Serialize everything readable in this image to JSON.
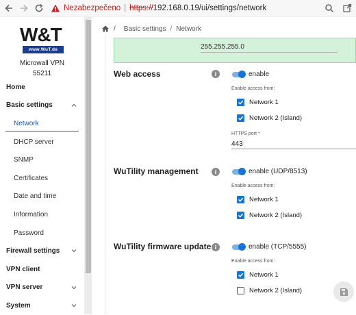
{
  "browser": {
    "insecure_label": "Nezabezpečeno",
    "url_scheme": "https://",
    "url_rest": "192.168.0.19/ui/settings/network"
  },
  "sidebar": {
    "logo_text": "W&T",
    "logo_sub": "www.WuT.de",
    "device_name": "Microwall VPN",
    "device_id": "55211",
    "items": [
      {
        "label": "Home",
        "type": "top"
      },
      {
        "label": "Basic settings",
        "type": "top",
        "chevron": "up"
      },
      {
        "label": "Network",
        "type": "sub",
        "active": true
      },
      {
        "label": "DHCP server",
        "type": "sub"
      },
      {
        "label": "SNMP",
        "type": "sub"
      },
      {
        "label": "Certificates",
        "type": "sub"
      },
      {
        "label": "Date and time",
        "type": "sub"
      },
      {
        "label": "Information",
        "type": "sub"
      },
      {
        "label": "Password",
        "type": "sub"
      },
      {
        "label": "Firewall settings",
        "type": "top",
        "chevron": "down"
      },
      {
        "label": "VPN client",
        "type": "top"
      },
      {
        "label": "VPN server",
        "type": "top",
        "chevron": "down"
      },
      {
        "label": "System",
        "type": "top",
        "chevron": "down"
      }
    ]
  },
  "breadcrumb": {
    "items": [
      "Basic settings",
      "Network"
    ]
  },
  "network": {
    "subnet_mask_value": "255.255.255.0"
  },
  "web_access": {
    "title": "Web access",
    "toggle_label": "enable",
    "enabled": true,
    "access_from_label": "Enable access from:",
    "network1": "Network 1",
    "network1_checked": true,
    "network2": "Network 2 (Island)",
    "network2_checked": true,
    "port_label": "HTTPS port *",
    "port_value": "443"
  },
  "wutility": {
    "title": "WuTility management",
    "toggle_label": "enable (UDP/8513)",
    "enabled": true,
    "access_from_label": "Enable access from:",
    "network1": "Network 1",
    "network1_checked": true,
    "network2": "Network 2 (Island)",
    "network2_checked": true
  },
  "firmware": {
    "title": "WuTility firmware update",
    "toggle_label": "enable (TCP/5555)",
    "enabled": true,
    "access_from_label": "Enable access from:",
    "network1": "Network 1",
    "network1_checked": true,
    "network2": "Network 2 (Island)",
    "network2_checked": false
  },
  "colors": {
    "accent": "#1a73d0",
    "insecure": "#c5221f",
    "success_bg": "#d3f2d9"
  }
}
